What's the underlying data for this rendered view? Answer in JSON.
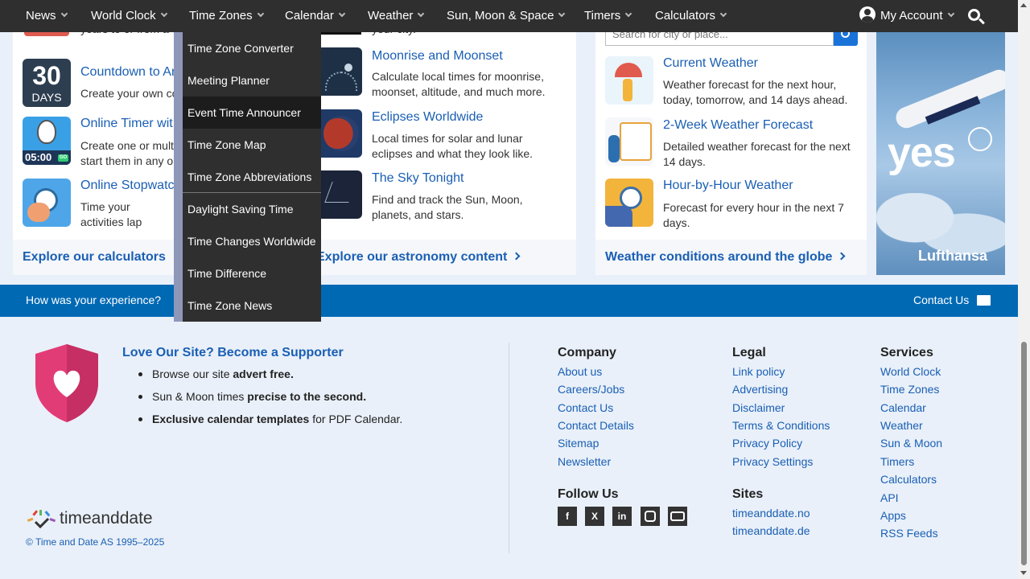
{
  "nav": {
    "items": [
      "News",
      "World Clock",
      "Time Zones",
      "Calendar",
      "Weather",
      "Sun, Moon & Space",
      "Timers",
      "Calculators"
    ],
    "account": "My Account"
  },
  "dropdown": {
    "items": [
      "Time Zone Converter",
      "Meeting Planner",
      "Event Time Announcer",
      "Time Zone Map",
      "Time Zone Abbreviations",
      "Daylight Saving Time",
      "Time Changes Worldwide",
      "Time Difference",
      "Time Zone News"
    ],
    "active_index": 2
  },
  "calculators": {
    "partial_top_text": "years to or from a",
    "thumb_days_number": "30",
    "thumb_days_label": "DAYS",
    "thumb_timer_time": "05:00",
    "thumb_timer_go": "GO",
    "items": [
      {
        "title": "Countdown to An",
        "desc": "Create your own co"
      },
      {
        "title": "Online Timer wit",
        "desc": "Create one or mult start them in any o"
      },
      {
        "title": "Online Stopwatc",
        "desc": "Time your activities lap times, and alar"
      }
    ],
    "explore": "Explore our calculators"
  },
  "astronomy": {
    "partial_top_text": "your city.",
    "items": [
      {
        "title": "Moonrise and Moonset",
        "desc": "Calculate local times for moonrise, moonset, altitude, and much more."
      },
      {
        "title": "Eclipses Worldwide",
        "desc": "Local times for solar and lunar eclipses and what they look like."
      },
      {
        "title": "The Sky Tonight",
        "desc": "Find and track the Sun, Moon, planets, and stars."
      }
    ],
    "explore": "Explore our astronomy content"
  },
  "weather": {
    "search_placeholder": "Search for city or place...",
    "items": [
      {
        "title": "Current Weather",
        "desc": "Weather forecast for the next hour, today, tomorrow, and 14 days ahead."
      },
      {
        "title": "2-Week Weather Forecast",
        "desc": "Detailed weather forecast for the next 14 days."
      },
      {
        "title": "Hour-by-Hour Weather",
        "desc": "Forecast for every hour in the next 7 days."
      }
    ],
    "explore": "Weather conditions around the globe"
  },
  "ad": {
    "headline": "yes",
    "brand": "Lufthansa"
  },
  "feedback": {
    "question": "How was your experience?",
    "contact": "Contact Us"
  },
  "supporter": {
    "title": "Love Our Site? Become a Supporter",
    "bullets": [
      {
        "plain": "Browse our site ",
        "bold": "advert free.",
        "after": ""
      },
      {
        "plain": "Sun & Moon times ",
        "bold": "precise to the second.",
        "after": ""
      },
      {
        "plain": "",
        "bold": "Exclusive calendar templates",
        "after": " for PDF Calendar."
      }
    ]
  },
  "brand": {
    "logo_text": "timeanddate",
    "copyright": "© Time and Date AS 1995–2025"
  },
  "footer": {
    "company": {
      "heading": "Company",
      "links": [
        "About us",
        "Careers/Jobs",
        "Contact Us",
        "Contact Details",
        "Sitemap",
        "Newsletter"
      ]
    },
    "legal": {
      "heading": "Legal",
      "links": [
        "Link policy",
        "Advertising",
        "Disclaimer",
        "Terms & Conditions",
        "Privacy Policy",
        "Privacy Settings"
      ]
    },
    "services": {
      "heading": "Services",
      "links": [
        "World Clock",
        "Time Zones",
        "Calendar",
        "Weather",
        "Sun & Moon",
        "Timers",
        "Calculators",
        "API",
        "Apps",
        "RSS Feeds"
      ]
    },
    "follow": {
      "heading": "Follow Us",
      "icons": [
        "facebook-icon",
        "x-icon",
        "linkedin-icon",
        "instagram-icon",
        "youtube-icon"
      ]
    },
    "sites": {
      "heading": "Sites",
      "links": [
        "timeanddate.no",
        "timeanddate.de"
      ]
    }
  },
  "colors": {
    "nav_bg": "#2f2f2f",
    "feedback_bg": "#0069b4",
    "link": "#1a5fb4",
    "footer_bg": "#e9f0f9"
  }
}
